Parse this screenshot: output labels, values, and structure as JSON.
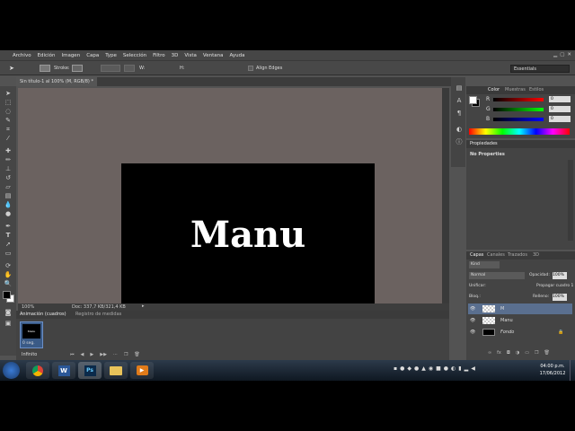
{
  "menu": [
    "Archivo",
    "Edición",
    "Imagen",
    "Capa",
    "Type",
    "Selección",
    "Filtro",
    "3D",
    "Vista",
    "Ventana",
    "Ayuda"
  ],
  "options": {
    "stroke_label": "Stroke:",
    "align_label": "Align Edges",
    "w_label": "W:",
    "h_label": "H:",
    "workspace": "Essentials"
  },
  "document": {
    "tab_title": "Sin título-1 al 100% (M, RGB/8) *",
    "text": "Manu",
    "zoom": "100%",
    "doc_info": "Doc: 337,7 KB/321,4 KB"
  },
  "timeline": {
    "tab_active": "Animación (cuadros)",
    "tab_other": "Registro de medidas",
    "frame_time": "0 seg.",
    "loop": "Infinito",
    "frame_thumb_text": "Manu"
  },
  "color_panel": {
    "tabs": [
      "Color",
      "Muestras",
      "Estilos"
    ],
    "channels": [
      {
        "label": "R",
        "value": "0"
      },
      {
        "label": "G",
        "value": "0"
      },
      {
        "label": "B",
        "value": "0"
      }
    ]
  },
  "properties": {
    "title": "Propiedades",
    "body": "No Properties"
  },
  "layers": {
    "tabs": [
      "Capas",
      "Canales",
      "Trazados",
      "3D"
    ],
    "kind": "Kind",
    "blend": "Normal",
    "opacity_label": "Opacidad:",
    "opacity": "100%",
    "unify_label": "Unificar:",
    "propagate_label": "Propagar cuadro 1",
    "lock_label": "Bloq.:",
    "fill_label": "Relleno:",
    "fill": "100%",
    "items": [
      {
        "name": "M"
      },
      {
        "name": "Manu"
      },
      {
        "name": "Fondo"
      }
    ]
  },
  "taskbar": {
    "time": "04:00 p.m.",
    "date": "17/06/2012",
    "apps": [
      "chrome",
      "word",
      "photoshop",
      "explorer",
      "media-player"
    ],
    "ps_label": "Ps",
    "word_label": "W"
  },
  "colors": {
    "accent": "#6b8fc7",
    "canvas_bg": "#6b6260"
  }
}
